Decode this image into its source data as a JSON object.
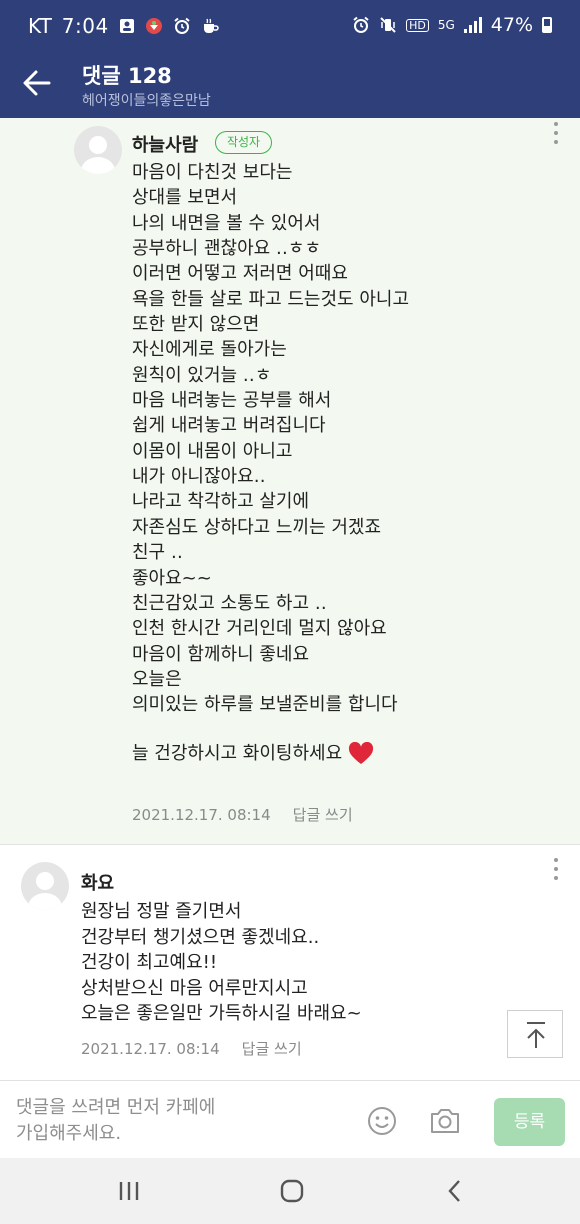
{
  "status_bar": {
    "carrier": "KT",
    "time": "7:04",
    "network_hd": "HD",
    "network_5g": "5G",
    "battery": "47%"
  },
  "header": {
    "title": "댓글 128",
    "subtitle": "헤어쟁이들의좋은만남"
  },
  "comments": [
    {
      "author": "하늘사람",
      "badge": "작성자",
      "lines": [
        "마음이 다친것 보다는",
        "상대를 보면서",
        "나의 내면을 볼 수 있어서",
        "공부하니 괜찮아요 ‥ㅎㅎ",
        "이러면 어떻고 저러면 어때요",
        "욕을 한들 살로 파고 드는것도 아니고",
        "또한 받지 않으면",
        "자신에게로 돌아가는",
        "원칙이 있거늘 ‥ㅎ",
        "마음 내려놓는 공부를 해서",
        "쉽게 내려놓고 버려집니다",
        "이몸이 내몸이 아니고",
        "내가 아니잖아요‥",
        "나라고 착각하고 살기에",
        "자존심도 상하다고 느끼는 거겠죠",
        "친구 ‥",
        "좋아요~~",
        "친근감있고 소통도 하고 ‥",
        "인천 한시간 거리인데 멀지 않아요",
        "마음이 함께하니 좋네요",
        "오늘은",
        "의미있는 하루를 보낼준비를 합니다"
      ],
      "closing": "늘 건강하시고 화이팅하세요",
      "closing_emoji": "heart-emoji",
      "date": "2021.12.17. 08:14",
      "reply_label": "답글 쓰기"
    },
    {
      "author": "화요",
      "lines": [
        "원장님 정말 즐기면서",
        "건강부터 챙기셨으면 좋겠네요..",
        "건강이 최고예요!!",
        "상처받으신 마음 어루만지시고",
        "오늘은 좋은일만 가득하시길 바래요~"
      ],
      "date": "2021.12.17. 08:14",
      "reply_label": "답글 쓰기"
    }
  ],
  "input": {
    "placeholder": "댓글을 쓰려면 먼저 카페에\n가입해주세요.",
    "submit_label": "등록"
  },
  "icons": {
    "back": "arrow-left-icon",
    "more": "more-vertical-icon",
    "scroll_top": "arrow-up-to-top-icon",
    "emoji": "smile-icon",
    "camera": "camera-icon",
    "nav_recent": "recent-apps-icon",
    "nav_home": "home-icon",
    "nav_back": "chevron-left-icon"
  },
  "colors": {
    "header_bg": "#2f3f79",
    "comment_highlight_bg": "#f3f9f0",
    "badge_green": "#3bb34a",
    "submit_bg": "#a7dcb2",
    "heart": "#e0273a"
  }
}
